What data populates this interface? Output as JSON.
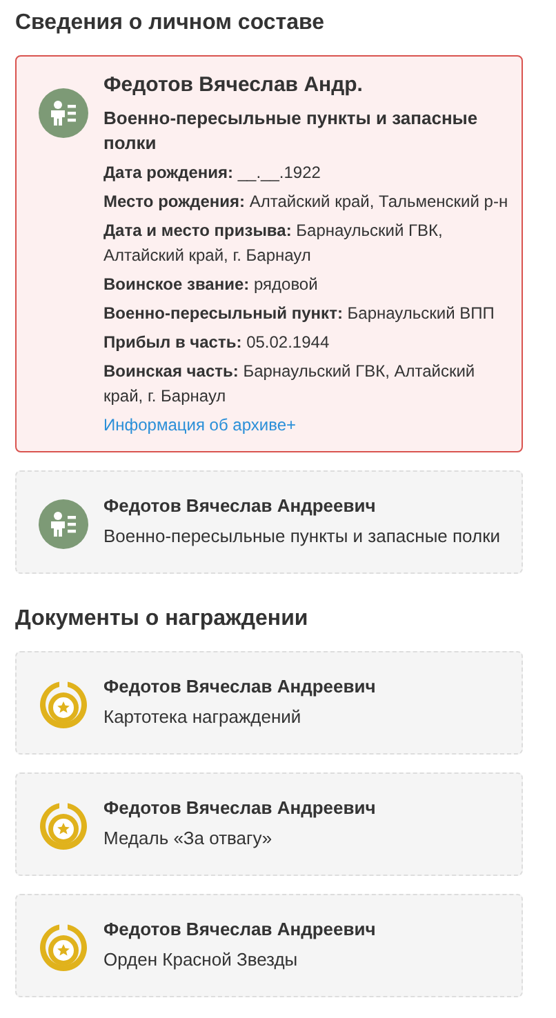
{
  "sections": [
    {
      "title": "Сведения о личном составе",
      "kind": "personnel",
      "cards": [
        {
          "name": "Федотов Вячеслав Андр.",
          "subtitle": "Военно-пересыльные пункты и запасные полки",
          "selected": true,
          "details": [
            "**Дата рождения:** __.__.1922",
            "**Место рождения:** Алтайский край, Тальменский р-н",
            "**Дата и место призыва:** Барнаульский ГВК, Алтайский край, г. Барнаул",
            "**Воинское звание:** рядовой",
            "**Военно-пересыльный пункт:** Барнаульский ВПП",
            "**Прибыл в часть:** 05.02.1944",
            "**Воинская часть:** Барнаульский ГВК, Алтайский край, г. Барнаул"
          ],
          "link": "Информация об архиве+"
        },
        {
          "name": "Федотов Вячеслав Андреевич",
          "subtitle": "Военно-пересыльные пункты и запасные полки",
          "selected": false
        }
      ]
    },
    {
      "title": "Документы о награждении",
      "kind": "awards",
      "cards": [
        {
          "name": "Федотов Вячеслав Андреевич",
          "subtitle": "Картотека награждений",
          "selected": false
        },
        {
          "name": "Федотов Вячеслав Андреевич",
          "subtitle": "Медаль «За отвагу»",
          "selected": false
        },
        {
          "name": "Федотов Вячеслав Андреевич",
          "subtitle": "Орден Красной Звезды",
          "selected": false
        }
      ]
    }
  ]
}
